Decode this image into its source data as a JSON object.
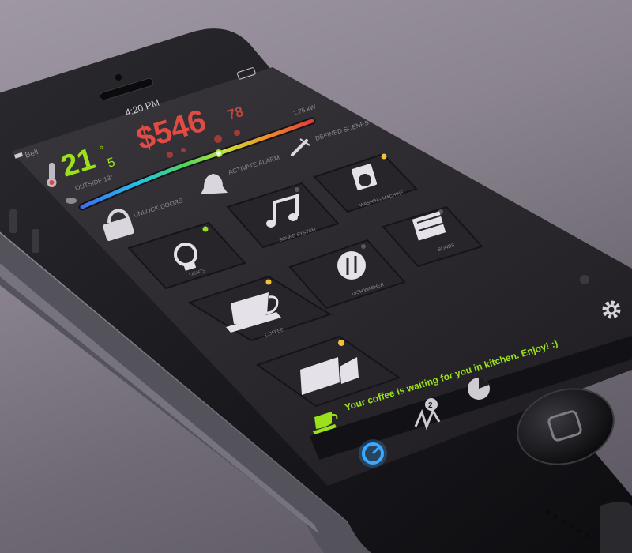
{
  "status_bar": {
    "carrier": "Bell",
    "time": "4:20 PM"
  },
  "temperature": {
    "value": "21",
    "unit": "°",
    "decimal": "5",
    "label": "OUTSIDE 13°"
  },
  "cost": {
    "dollars": "$546",
    "cents": "78",
    "rate": "1.75 kW"
  },
  "gauge": {
    "level": 0.62
  },
  "quick_actions": {
    "defined_scenes": "DEFINED SCENES",
    "activate_alarm": "ACTIVATE ALARM",
    "unlock_doors": "UNLOCK DOORS"
  },
  "tiles": {
    "washing_machine": "WASHING MACHINE",
    "sound_system": "SOUND SYSTEM",
    "blinds": "BLINDS",
    "lights": "LIGHTS",
    "dish_washer": "DISH WASHER",
    "coffee": "COFFEE",
    "camera": "CAMERA"
  },
  "notification": {
    "message": "Your coffee is waiting for you in kitchen. Enjoy! :)"
  },
  "tab_bar": {
    "activity_badge": "2"
  },
  "colors": {
    "accent_green": "#9be21c",
    "cost_red": "#e24a44",
    "led_yellow": "#f1c235",
    "tab_blue": "#39a8ff"
  },
  "icons": [
    "thermometer-icon",
    "scenes-icon",
    "bell-icon",
    "lock-icon",
    "washing-machine-icon",
    "music-note-icon",
    "blinds-icon",
    "lightbulb-icon",
    "fork-knife-icon",
    "coffee-cup-icon",
    "video-camera-icon",
    "settings-gear-icon",
    "dashboard-icon",
    "activity-icon",
    "pie-chart-icon",
    "coffee-notification-icon"
  ]
}
